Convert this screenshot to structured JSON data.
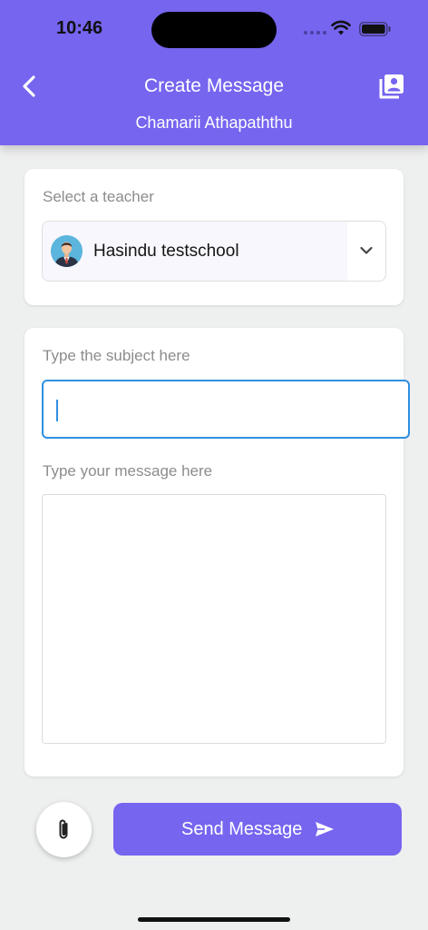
{
  "status_bar": {
    "time": "10:46"
  },
  "header": {
    "title": "Create Message",
    "subtitle": "Chamarii Athapaththu",
    "color": "#7565ef"
  },
  "teacher_section": {
    "label": "Select a teacher",
    "selected_teacher": "Hasindu testschool"
  },
  "message_section": {
    "subject_placeholder": "Type the subject here",
    "subject_value": "",
    "message_placeholder": "Type your message here",
    "message_value": ""
  },
  "actions": {
    "attach_icon": "paperclip-icon",
    "send_label": "Send Message",
    "send_icon": "send-icon"
  },
  "colors": {
    "accent": "#7565ef",
    "focus": "#2f8fe0",
    "background": "#eeefef"
  }
}
